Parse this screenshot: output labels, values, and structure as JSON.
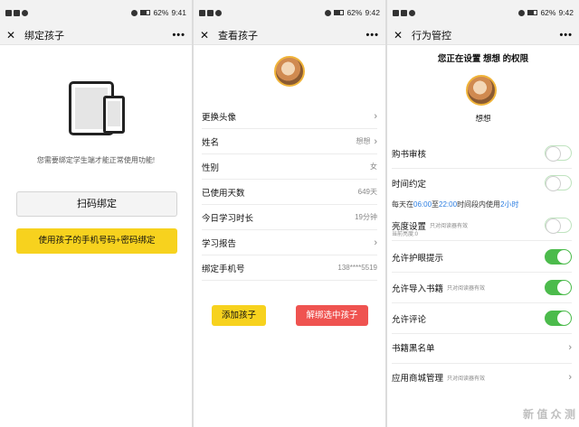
{
  "status_bars": [
    {
      "battery": "62%",
      "time": "9:41"
    },
    {
      "battery": "62%",
      "time": "9:42"
    },
    {
      "battery": "62%",
      "time": "9:42"
    }
  ],
  "screen1": {
    "title": "绑定孩子",
    "notice": "您需要绑定学生端才能正常使用功能!",
    "scan_button": "扫码绑定",
    "phone_button": "使用孩子的手机号码+密码绑定"
  },
  "screen2": {
    "title": "查看孩子",
    "rows": [
      {
        "label": "更换头像",
        "value": ""
      },
      {
        "label": "姓名",
        "value": "想想"
      },
      {
        "label": "性别",
        "value": "女"
      },
      {
        "label": "已使用天数",
        "value": "649天"
      },
      {
        "label": "今日学习时长",
        "value": "19分钟"
      },
      {
        "label": "学习报告",
        "value": ""
      },
      {
        "label": "绑定手机号",
        "value": "138****5519"
      }
    ],
    "add_button": "添加孩子",
    "unbind_button": "解绑选中孩子"
  },
  "screen3": {
    "title": "行为管控",
    "setting_title": "您正在设置 想想 的权限",
    "child_name": "想想",
    "book_review": "购书审核",
    "time_limit": "时间约定",
    "time_line": {
      "prefix": "每天在",
      "start": "06:00",
      "mid": "至",
      "end": "22:00",
      "suffix": "时间段内使用",
      "duration": "2小时"
    },
    "brightness": "亮度设置",
    "brightness_hint": "只对阅读器有效",
    "brightness_current": "当前亮度:0",
    "eye_care": "允许护眼提示",
    "import_books": "允许导入书籍",
    "import_hint": "只对阅读器有效",
    "comments": "允许评论",
    "blacklist": "书籍黑名单",
    "app_store": "应用商城管理",
    "app_store_hint": "只对阅读器有效"
  },
  "watermark": "新 值 众 测",
  "colors": {
    "accent_yellow": "#f7d21e",
    "danger_red": "#ef5350",
    "toggle_green": "#4cbb4c",
    "link_blue": "#2a7de1"
  }
}
